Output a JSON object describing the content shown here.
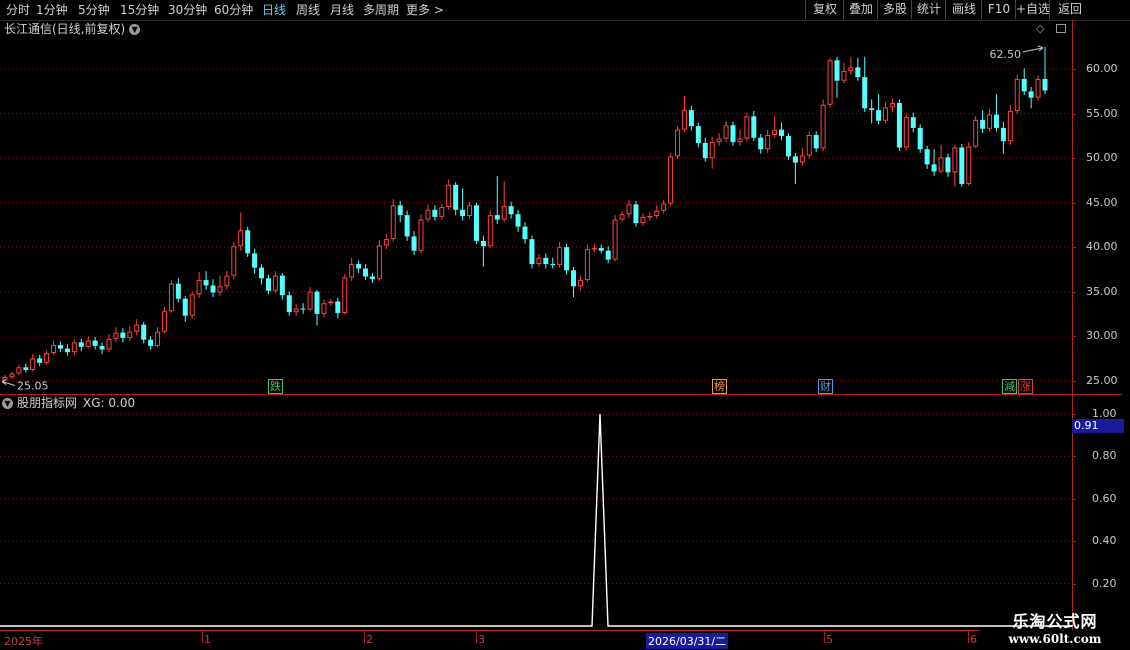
{
  "toolbar": {
    "periods": [
      "分时",
      "1分钟",
      "5分钟",
      "15分钟",
      "30分钟",
      "60分钟",
      "日线",
      "周线",
      "月线",
      "多周期",
      "更多 >"
    ],
    "active_period": "日线",
    "actions": [
      "复权",
      "叠加",
      "多股",
      "统计",
      "画线",
      "F10",
      "+自选",
      "返回"
    ]
  },
  "chart": {
    "title": "长江通信(日线,前复权)",
    "dropdown_icon": "chevron-down-icon",
    "top_right_icons": [
      "diamond-icon",
      "window-icon"
    ]
  },
  "price_axis": {
    "labels": [
      "60.00",
      "55.00",
      "50.00",
      "45.00",
      "40.00",
      "35.00",
      "30.00",
      "25.00"
    ],
    "high_label": "62.50",
    "low_label": "25.05"
  },
  "markers": [
    {
      "text": "跌",
      "color": "#39c36a"
    },
    {
      "text": "榜",
      "color": "#e0a040"
    },
    {
      "text": "财",
      "color": "#5a9ae0"
    },
    {
      "text": "減",
      "color": "#39c36a"
    },
    {
      "text": "涨",
      "color": "#e04040"
    }
  ],
  "indicator": {
    "name": "股朋指标网",
    "value_text": "XG: 0.00",
    "axis_labels": [
      "1.00",
      "0.80",
      "0.60",
      "0.40",
      "0.20"
    ],
    "current": "0.91"
  },
  "date_axis": {
    "labels": [
      "2025年",
      "1",
      "2",
      "3",
      "2026/03/31/二",
      "5",
      "6"
    ]
  },
  "watermark": {
    "line1": "乐淘公式网",
    "line2": "www.60lt.com"
  },
  "colors": {
    "up": "#ff4040",
    "down": "#54ffff",
    "grid": "#8a1010",
    "axis": "#b02020",
    "active_tab": "#5fd3e6"
  },
  "chart_data": {
    "type": "candlestick",
    "ylim": [
      23.5,
      63.5
    ],
    "candles": [
      [
        25.0,
        25.4,
        24.9,
        25.6
      ],
      [
        25.4,
        25.8,
        25.2,
        26.0
      ],
      [
        25.8,
        26.5,
        25.6,
        26.8
      ],
      [
        26.5,
        26.2,
        25.9,
        26.9
      ],
      [
        26.2,
        27.5,
        26.0,
        28.0
      ],
      [
        27.5,
        27.0,
        26.6,
        27.9
      ],
      [
        27.0,
        28.1,
        26.8,
        28.4
      ],
      [
        28.1,
        29.0,
        27.9,
        29.5
      ],
      [
        29.0,
        28.6,
        28.2,
        29.4
      ],
      [
        28.6,
        28.2,
        27.8,
        29.1
      ],
      [
        28.2,
        29.3,
        27.9,
        29.6
      ],
      [
        29.3,
        28.8,
        28.3,
        29.7
      ],
      [
        28.8,
        29.5,
        28.6,
        30.0
      ],
      [
        29.5,
        28.9,
        28.5,
        29.9
      ],
      [
        28.9,
        28.5,
        28.0,
        29.3
      ],
      [
        28.5,
        29.7,
        28.2,
        30.2
      ],
      [
        29.7,
        30.4,
        29.3,
        31.0
      ],
      [
        30.4,
        29.8,
        29.3,
        30.9
      ],
      [
        29.8,
        30.5,
        29.5,
        31.1
      ],
      [
        30.5,
        31.3,
        30.1,
        31.9
      ],
      [
        31.3,
        29.6,
        29.2,
        31.6
      ],
      [
        29.6,
        28.9,
        28.5,
        30.0
      ],
      [
        28.9,
        30.5,
        28.7,
        31.0
      ],
      [
        30.5,
        32.8,
        30.3,
        33.3
      ],
      [
        32.8,
        35.9,
        32.6,
        36.3
      ],
      [
        35.9,
        34.2,
        33.8,
        36.5
      ],
      [
        34.2,
        32.3,
        31.6,
        34.5
      ],
      [
        32.3,
        34.7,
        32.0,
        35.0
      ],
      [
        34.7,
        36.3,
        34.3,
        37.2
      ],
      [
        36.3,
        35.7,
        35.2,
        37.3
      ],
      [
        35.7,
        34.9,
        34.4,
        36.4
      ],
      [
        34.9,
        35.6,
        34.5,
        36.8
      ],
      [
        35.6,
        36.8,
        35.2,
        37.3
      ],
      [
        36.8,
        40.1,
        36.4,
        40.6
      ],
      [
        40.1,
        41.9,
        39.6,
        43.9
      ],
      [
        41.9,
        39.3,
        38.9,
        42.3
      ],
      [
        39.3,
        37.7,
        37.0,
        39.8
      ],
      [
        37.7,
        36.5,
        35.8,
        38.1
      ],
      [
        36.5,
        35.1,
        34.7,
        36.9
      ],
      [
        35.1,
        36.8,
        34.8,
        37.3
      ],
      [
        36.8,
        34.6,
        34.1,
        37.1
      ],
      [
        34.6,
        32.7,
        32.3,
        35.0
      ],
      [
        32.7,
        33.1,
        32.3,
        33.6
      ],
      [
        33.1,
        33.0,
        32.5,
        33.7
      ],
      [
        33.0,
        35.0,
        32.8,
        35.5
      ],
      [
        35.0,
        32.5,
        31.2,
        35.2
      ],
      [
        32.5,
        33.7,
        32.1,
        34.1
      ],
      [
        33.7,
        33.9,
        33.4,
        34.2
      ],
      [
        33.9,
        32.6,
        32.0,
        34.3
      ],
      [
        32.6,
        36.6,
        32.4,
        37.0
      ],
      [
        36.6,
        38.1,
        36.2,
        38.8
      ],
      [
        38.1,
        37.6,
        37.1,
        38.5
      ],
      [
        37.6,
        36.7,
        36.3,
        38.1
      ],
      [
        36.7,
        36.4,
        36.0,
        37.1
      ],
      [
        36.4,
        40.2,
        36.2,
        40.8
      ],
      [
        40.2,
        40.9,
        39.8,
        41.5
      ],
      [
        40.9,
        44.7,
        40.6,
        45.4
      ],
      [
        44.7,
        43.6,
        42.8,
        45.2
      ],
      [
        43.6,
        41.2,
        40.7,
        44.1
      ],
      [
        41.2,
        39.6,
        39.1,
        41.8
      ],
      [
        39.6,
        43.1,
        39.3,
        43.7
      ],
      [
        43.1,
        44.2,
        42.8,
        44.8
      ],
      [
        44.2,
        43.4,
        43.0,
        44.7
      ],
      [
        43.4,
        44.5,
        43.1,
        44.9
      ],
      [
        44.5,
        47.0,
        44.2,
        47.6
      ],
      [
        47.0,
        44.2,
        43.6,
        47.3
      ],
      [
        44.2,
        43.5,
        43.0,
        46.6
      ],
      [
        43.5,
        44.7,
        43.2,
        45.1
      ],
      [
        44.7,
        40.7,
        40.3,
        45.0
      ],
      [
        40.7,
        40.1,
        37.8,
        41.3
      ],
      [
        40.1,
        43.6,
        39.9,
        44.1
      ],
      [
        43.6,
        43.1,
        42.6,
        48.0
      ],
      [
        43.1,
        44.6,
        42.8,
        47.4
      ],
      [
        44.6,
        43.7,
        43.2,
        45.1
      ],
      [
        43.7,
        42.3,
        41.7,
        44.2
      ],
      [
        42.3,
        40.9,
        40.4,
        42.8
      ],
      [
        40.9,
        38.1,
        37.6,
        41.3
      ],
      [
        38.1,
        38.8,
        37.8,
        39.2
      ],
      [
        38.8,
        38.1,
        37.6,
        39.3
      ],
      [
        38.1,
        38.0,
        37.6,
        38.8
      ],
      [
        38.0,
        40.0,
        37.7,
        40.6
      ],
      [
        40.0,
        37.4,
        36.9,
        40.4
      ],
      [
        37.4,
        35.6,
        34.4,
        37.8
      ],
      [
        35.6,
        36.3,
        35.2,
        36.8
      ],
      [
        36.3,
        39.8,
        36.1,
        40.3
      ],
      [
        39.8,
        39.9,
        39.4,
        40.4
      ],
      [
        39.9,
        39.6,
        39.3,
        40.3
      ],
      [
        39.6,
        38.6,
        38.2,
        40.1
      ],
      [
        38.6,
        43.1,
        38.4,
        43.6
      ],
      [
        43.1,
        43.7,
        42.8,
        44.0
      ],
      [
        43.7,
        44.8,
        43.3,
        45.3
      ],
      [
        44.8,
        42.7,
        42.3,
        45.2
      ],
      [
        42.7,
        43.4,
        42.4,
        43.8
      ],
      [
        43.4,
        43.5,
        43.0,
        43.9
      ],
      [
        43.5,
        44.1,
        43.2,
        44.7
      ],
      [
        44.1,
        44.9,
        43.8,
        45.3
      ],
      [
        44.9,
        50.2,
        44.7,
        50.6
      ],
      [
        50.2,
        53.2,
        49.9,
        53.6
      ],
      [
        53.2,
        55.4,
        52.9,
        57.0
      ],
      [
        55.4,
        53.6,
        53.1,
        55.9
      ],
      [
        53.6,
        51.7,
        51.2,
        54.0
      ],
      [
        51.7,
        50.0,
        49.6,
        52.3
      ],
      [
        50.0,
        51.8,
        48.8,
        52.4
      ],
      [
        51.8,
        52.2,
        51.4,
        52.8
      ],
      [
        52.2,
        53.7,
        51.8,
        54.2
      ],
      [
        53.7,
        51.8,
        51.4,
        54.1
      ],
      [
        51.8,
        52.2,
        51.4,
        53.2
      ],
      [
        52.2,
        54.7,
        51.9,
        55.1
      ],
      [
        54.7,
        52.3,
        51.9,
        55.3
      ],
      [
        52.3,
        51.0,
        50.5,
        52.7
      ],
      [
        51.0,
        52.6,
        50.6,
        53.2
      ],
      [
        52.6,
        53.2,
        52.3,
        54.7
      ],
      [
        53.2,
        52.5,
        52.0,
        54.0
      ],
      [
        52.5,
        50.2,
        49.8,
        52.8
      ],
      [
        50.2,
        49.5,
        47.1,
        50.6
      ],
      [
        49.5,
        50.3,
        49.1,
        51.1
      ],
      [
        50.3,
        52.6,
        50.0,
        53.0
      ],
      [
        52.6,
        51.1,
        50.7,
        53.0
      ],
      [
        51.1,
        56.0,
        50.8,
        56.6
      ],
      [
        56.0,
        61.0,
        55.7,
        61.2
      ],
      [
        61.0,
        58.7,
        56.8,
        61.4
      ],
      [
        58.7,
        59.8,
        58.4,
        60.7
      ],
      [
        59.8,
        60.2,
        59.4,
        61.4
      ],
      [
        60.2,
        59.1,
        58.7,
        61.3
      ],
      [
        59.1,
        55.6,
        55.2,
        61.4
      ],
      [
        55.6,
        55.4,
        53.9,
        56.6
      ],
      [
        55.4,
        54.2,
        53.8,
        57.2
      ],
      [
        54.2,
        55.7,
        53.9,
        56.3
      ],
      [
        55.7,
        56.2,
        55.2,
        56.7
      ],
      [
        56.2,
        51.2,
        50.8,
        56.6
      ],
      [
        51.2,
        54.6,
        50.9,
        55.0
      ],
      [
        54.6,
        53.4,
        52.9,
        55.1
      ],
      [
        53.4,
        51.0,
        50.6,
        53.8
      ],
      [
        51.0,
        49.3,
        48.8,
        51.4
      ],
      [
        49.3,
        48.5,
        48.0,
        51.0
      ],
      [
        48.5,
        50.1,
        48.3,
        51.5
      ],
      [
        50.1,
        48.4,
        47.9,
        50.5
      ],
      [
        48.4,
        51.2,
        46.8,
        51.5
      ],
      [
        51.2,
        47.1,
        46.8,
        51.6
      ],
      [
        47.1,
        51.3,
        46.9,
        51.8
      ],
      [
        51.3,
        54.3,
        51.1,
        54.7
      ],
      [
        54.3,
        53.3,
        52.8,
        55.4
      ],
      [
        53.3,
        54.9,
        53.0,
        55.5
      ],
      [
        54.9,
        53.4,
        53.0,
        57.2
      ],
      [
        53.4,
        51.9,
        50.5,
        54.1
      ],
      [
        51.9,
        55.3,
        51.5,
        56.0
      ],
      [
        55.3,
        58.9,
        55.0,
        59.4
      ],
      [
        58.9,
        57.5,
        57.1,
        60.1
      ],
      [
        57.5,
        56.8,
        55.6,
        58.0
      ],
      [
        56.8,
        58.9,
        56.5,
        59.3
      ],
      [
        58.9,
        57.6,
        57.2,
        62.5
      ]
    ]
  }
}
